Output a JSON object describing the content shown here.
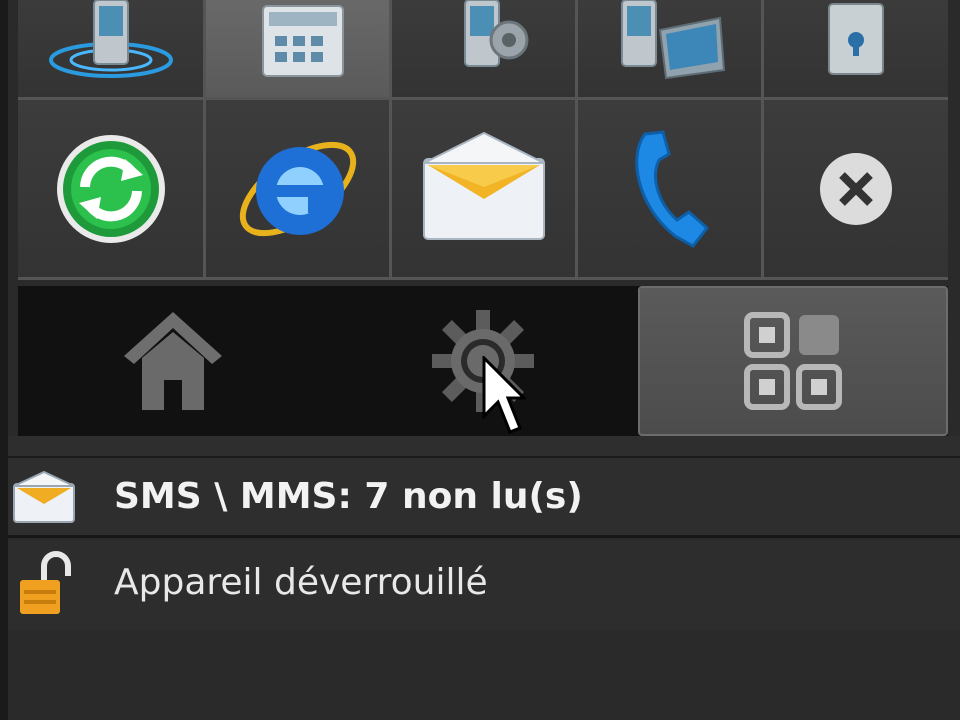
{
  "grid": {
    "row1": [
      {
        "icon": "phone-wireless-icon"
      },
      {
        "icon": "phone-calendar-icon",
        "selected": true
      },
      {
        "icon": "phone-settings-icon"
      },
      {
        "icon": "phone-sync-icon"
      },
      {
        "icon": "device-lock-icon"
      }
    ],
    "row2": [
      {
        "icon": "sync-green-icon"
      },
      {
        "icon": "internet-explorer-icon"
      },
      {
        "icon": "mail-envelope-icon"
      },
      {
        "icon": "phone-handset-icon"
      },
      {
        "icon": "close-x-icon"
      }
    ]
  },
  "tabbar": {
    "tabs": [
      {
        "icon": "home-icon"
      },
      {
        "icon": "settings-gear-icon"
      },
      {
        "icon": "apps-grid-icon",
        "selected": true
      }
    ]
  },
  "notifications": {
    "sms": {
      "text": "SMS \\ MMS: 7 non lu(s)",
      "icon": "envelope-icon"
    },
    "lock": {
      "text": "Appareil déverrouillé",
      "icon": "unlocked-padlock-icon"
    }
  },
  "colors": {
    "background": "#2a2a2a",
    "tabbar": "#111111",
    "selected_tile": "#5e5e5e",
    "accent_orange": "#f0a020",
    "accent_blue": "#1e90ff"
  }
}
